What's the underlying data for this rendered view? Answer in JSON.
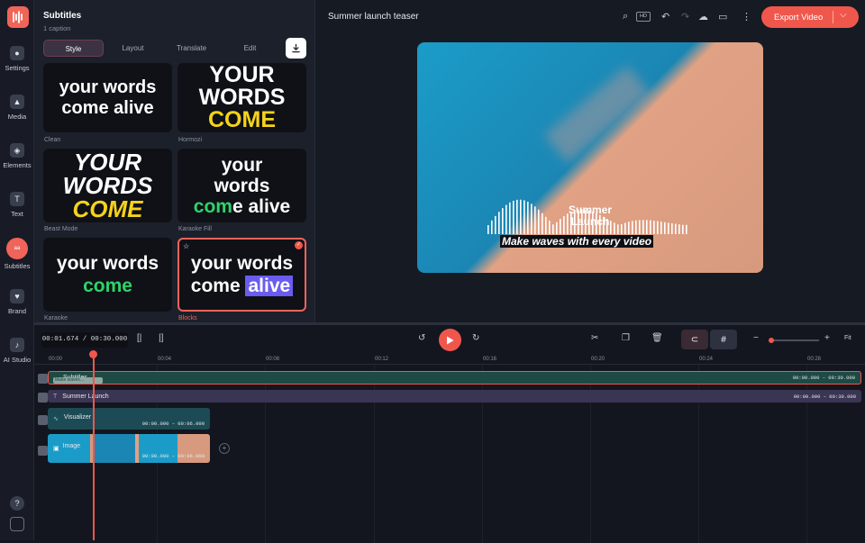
{
  "rail": {
    "items": [
      {
        "label": "Settings",
        "icon": "settings-icon"
      },
      {
        "label": "Media",
        "icon": "media-icon"
      },
      {
        "label": "Elements",
        "icon": "elements-icon"
      },
      {
        "label": "Text",
        "icon": "text-icon"
      },
      {
        "label": "Subtitles",
        "icon": "subtitles-icon"
      },
      {
        "label": "Brand",
        "icon": "brand-icon"
      },
      {
        "label": "AI Studio",
        "icon": "microphone-icon"
      }
    ]
  },
  "panel": {
    "title": "Subtitles",
    "subtitle": "1 caption",
    "tabs": [
      "Style",
      "Layout",
      "Translate",
      "Edit"
    ],
    "styles": [
      {
        "name": "Clean",
        "line1": "your words",
        "line2": "come alive",
        "line3": ""
      },
      {
        "name": "Hormozi",
        "line1": "YOUR",
        "line2": "WORDS",
        "line3": "COME"
      },
      {
        "name": "Beast Mode",
        "line1": "YOUR",
        "line2": "WORDS",
        "line3": "COME"
      },
      {
        "name": "Karaoke Fill",
        "line1": "your",
        "line2": "words",
        "line3a": "com",
        "line3b": "e alive"
      },
      {
        "name": "Karaoke",
        "line1": "your words",
        "line2": "come",
        "line3": ""
      },
      {
        "name": "Blocks",
        "line1": "your words",
        "line2": "come",
        "line3": "alive"
      }
    ]
  },
  "header": {
    "project_title": "Summer launch teaser",
    "export_label": "Export Video",
    "hd_badge": "HD"
  },
  "video": {
    "title_line1": "Summer",
    "title_line2": "Launch",
    "caption": "Make waves with every video"
  },
  "timeline": {
    "current_time": "00:01.674",
    "total_time": "00:30.000",
    "zoom_label": "Fit",
    "ticks": [
      "00:00",
      "00:04",
      "00:08",
      "00:12",
      "00:16",
      "00:20",
      "00:24",
      "00:28"
    ],
    "tracks": [
      {
        "name": "Subtitles",
        "caption_chip": "Make waves…",
        "time": "00:00.000 – 00:30.000"
      },
      {
        "name": "Summer Launch",
        "time": "00:00.000 – 00:30.000"
      },
      {
        "name": "Visualizer",
        "time": "00:00.000 – 00:06.000"
      },
      {
        "name": "Image",
        "time": "00:00.000 – 00:06.000"
      }
    ]
  },
  "colors": {
    "accent": "#f0574c",
    "blocks_highlight": "#6a5cf0",
    "karaoke_green": "#2ed36a",
    "hormozi_yellow": "#f6d21a"
  }
}
